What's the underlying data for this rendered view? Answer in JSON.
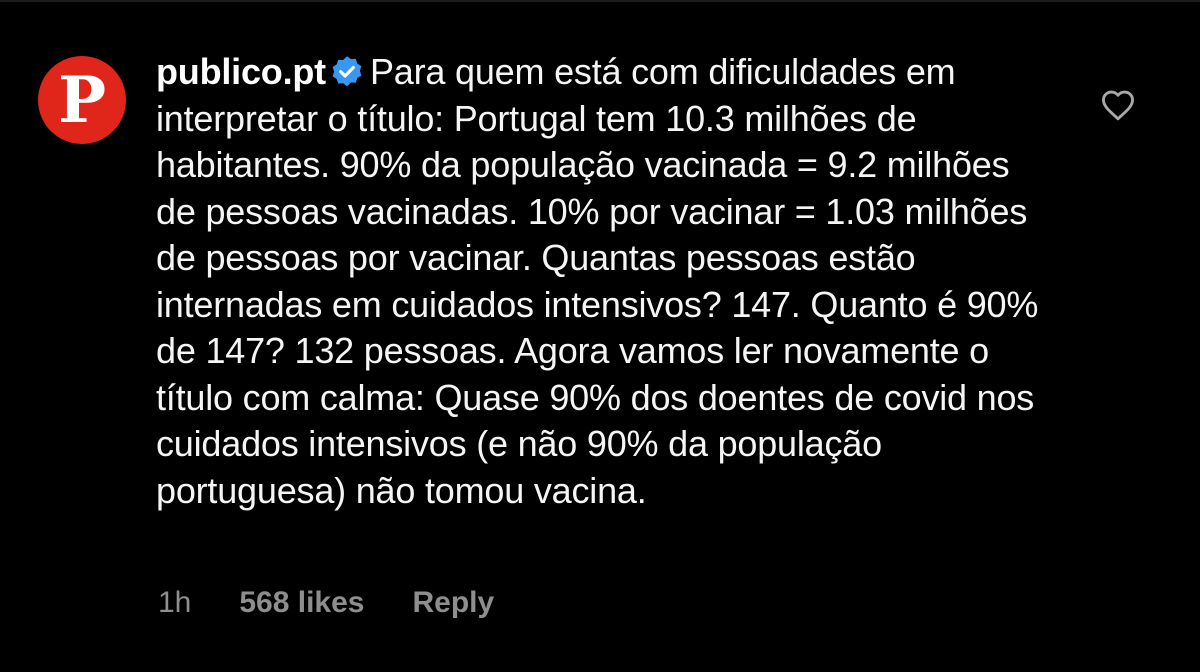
{
  "comment": {
    "avatar_letter": "P",
    "avatar_color": "#e0261b",
    "username": "publico.pt",
    "verified_icon": "verified-badge-icon",
    "verified_color": "#3897f0",
    "text": "Para quem está com dificuldades em interpretar o título: Portugal tem 10.3 milhões de habitantes. 90% da população vacinada = 9.2 milhões de pessoas vacinadas. 10% por vacinar = 1.03 milhões de pessoas por vacinar. Quantas pessoas estão internadas em cuidados intensivos? 147. Quanto é 90% de 147? 132 pessoas. Agora vamos ler novamente o título com calma: Quase 90% dos doentes de covid nos cuidados intensivos (e não 90% da população portuguesa) não tomou vacina.",
    "like_icon": "heart-outline-icon",
    "timestamp": "1h",
    "likes": "568 likes",
    "reply_label": "Reply"
  }
}
